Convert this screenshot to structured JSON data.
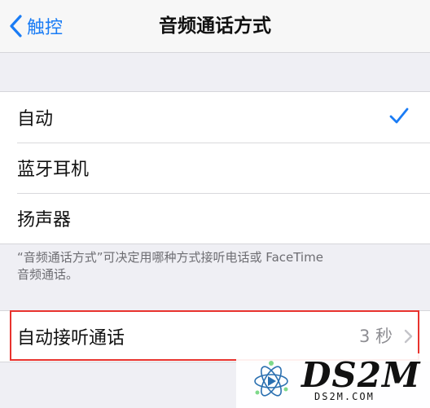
{
  "nav": {
    "back_label": "触控",
    "title": "音频通话方式"
  },
  "options": [
    {
      "label": "自动",
      "selected": true
    },
    {
      "label": "蓝牙耳机",
      "selected": false
    },
    {
      "label": "扬声器",
      "selected": false
    }
  ],
  "footer_text_1": "“音频通话方式”可决定用哪种方式接听电话或 FaceTime",
  "footer_text_2": "音频通话。",
  "auto_answer": {
    "label": "自动接听通话",
    "value": "3 秒"
  },
  "watermark": {
    "brand": "DS2M",
    "url": "DS2M.COM"
  },
  "colors": {
    "accent": "#1a7cf5",
    "highlight": "#e8332e"
  }
}
